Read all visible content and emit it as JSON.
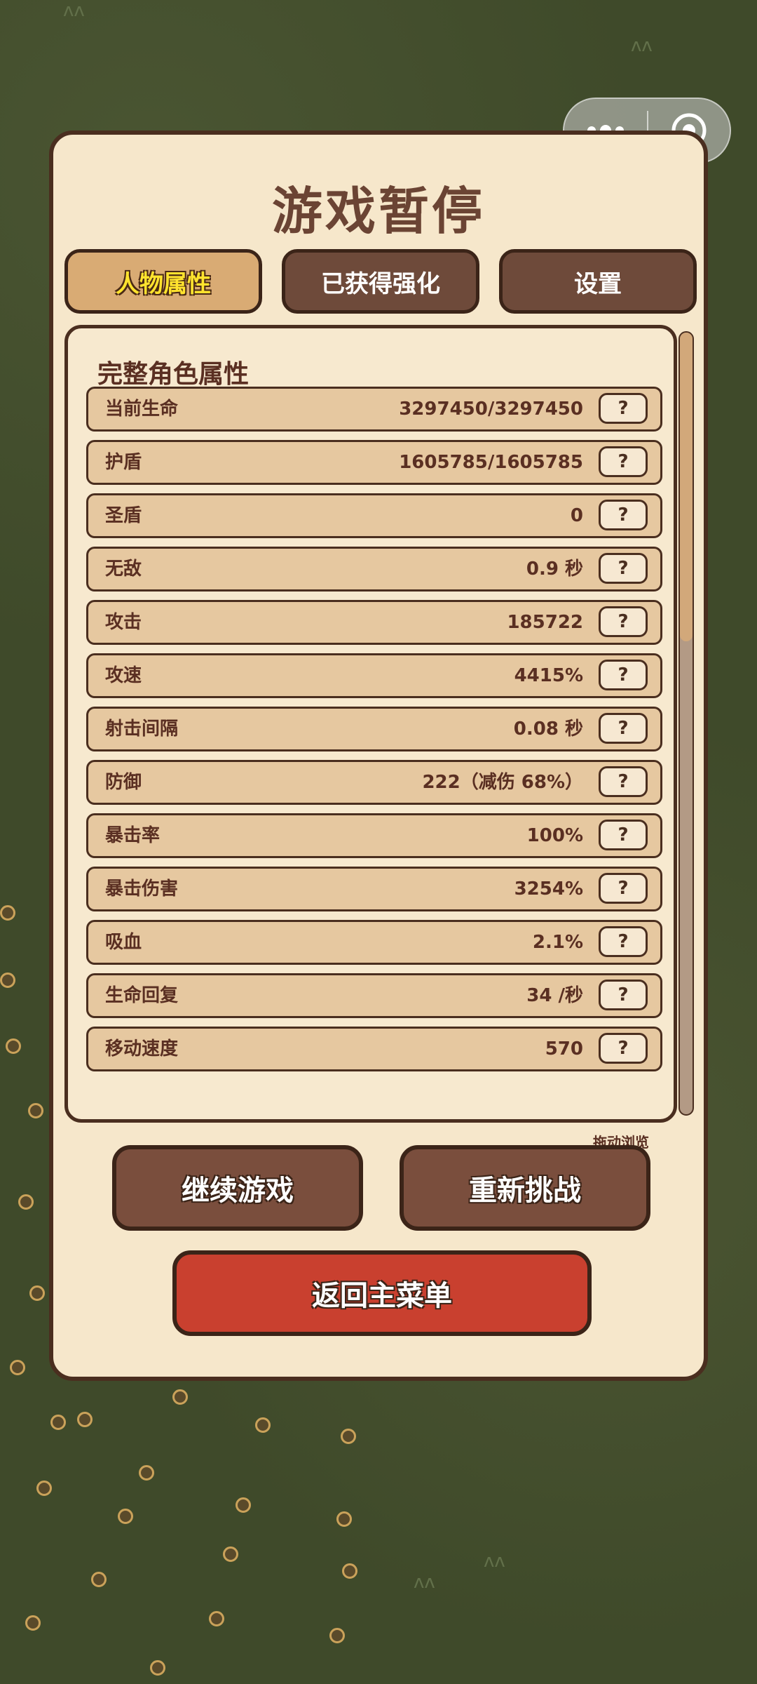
{
  "capsule": {
    "more_icon": "more-icon",
    "close_icon": "target-icon"
  },
  "title": "游戏暂停",
  "tabs": [
    {
      "label": "人物属性",
      "active": true
    },
    {
      "label": "已获得强化",
      "active": false
    },
    {
      "label": "设置",
      "active": false
    }
  ],
  "attributes": {
    "heading": "完整角色属性",
    "rows": [
      {
        "label": "当前生命",
        "value": "3297450/3297450",
        "help": "?"
      },
      {
        "label": "护盾",
        "value": "1605785/1605785",
        "help": "?"
      },
      {
        "label": "圣盾",
        "value": "0",
        "help": "?"
      },
      {
        "label": "无敌",
        "value": "0.9 秒",
        "help": "?"
      },
      {
        "label": "攻击",
        "value": "185722",
        "help": "?"
      },
      {
        "label": "攻速",
        "value": "4415%",
        "help": "?"
      },
      {
        "label": "射击间隔",
        "value": "0.08 秒",
        "help": "?"
      },
      {
        "label": "防御",
        "value": "222（减伤 68%）",
        "help": "?"
      },
      {
        "label": "暴击率",
        "value": "100%",
        "help": "?"
      },
      {
        "label": "暴击伤害",
        "value": "3254%",
        "help": "?"
      },
      {
        "label": "吸血",
        "value": "2.1%",
        "help": "?"
      },
      {
        "label": "生命回复",
        "value": "34 /秒",
        "help": "?"
      },
      {
        "label": "移动速度",
        "value": "570",
        "help": "?"
      }
    ]
  },
  "scroll_hint": "拖动浏览",
  "buttons": {
    "continue": "继续游戏",
    "restart": "重新挑战",
    "main_menu": "返回主菜单"
  }
}
